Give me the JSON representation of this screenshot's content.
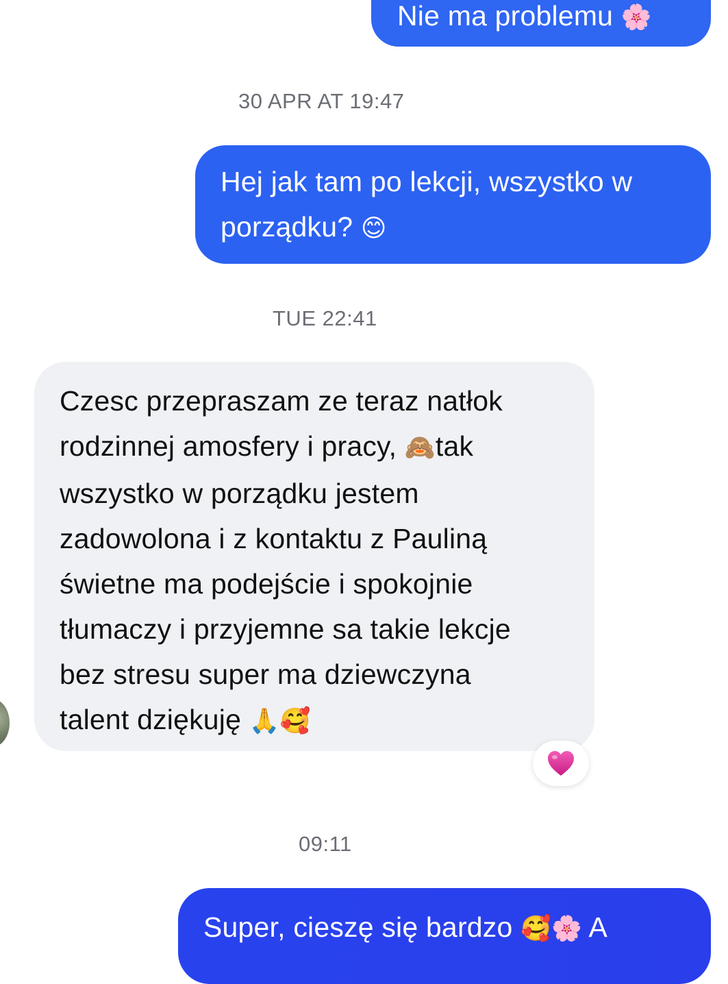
{
  "conversation": {
    "messages": [
      {
        "direction": "outgoing",
        "lines": [
          "Nie ma problemu"
        ],
        "trailing_emoji": "🌸"
      },
      {
        "direction": "outgoing",
        "lines": [
          "Hej jak tam po lekcji, wszystko w",
          "porządku?"
        ],
        "trailing_emoji": "😊"
      },
      {
        "direction": "incoming",
        "lines": [
          "Czesc przepraszam ze teraz natłok",
          "rodzinnej amosfery i pracy,",
          "wszystko w porządku jestem",
          "zadowolona i z kontaktu z Pauliną",
          "świetne ma podejście i spokojnie",
          "tłumaczy i przyjemne sa takie lekcje",
          "bez stresu super ma dziewczyna",
          "talent dziękuję"
        ],
        "inline_emoji": "🙈",
        "inline_after": "tak",
        "trailing_emoji": "🙏🥰",
        "reaction": "💗"
      },
      {
        "direction": "outgoing",
        "lines": [
          "Super, cieszę się bardzo"
        ],
        "trailing_emoji": "🥰🌸",
        "trailing_text": "A"
      }
    ],
    "timestamps": [
      "30 APR AT 19:47",
      "TUE 22:41",
      "09:11"
    ]
  },
  "colors": {
    "outgoing_bubble": "#2f66f2",
    "outgoing_bubble_bottom": "#2843ee",
    "incoming_bubble": "#eff1f5",
    "timestamp_text": "#6b6e74",
    "reaction_heart": "#e2349a"
  },
  "icons": {
    "reaction": "pink-heart-icon",
    "avatar": "contact-avatar"
  }
}
